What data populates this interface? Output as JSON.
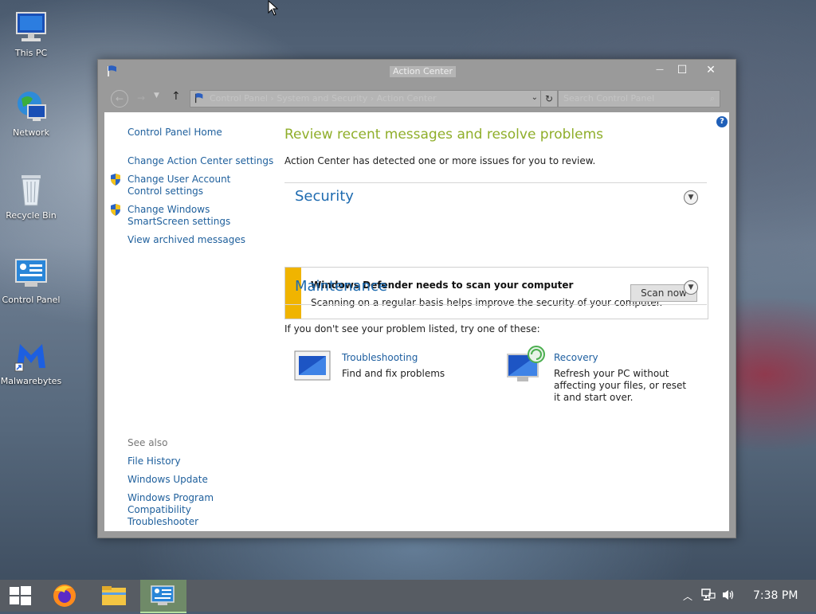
{
  "desktop": {
    "icons": [
      {
        "label": "This PC"
      },
      {
        "label": "Network"
      },
      {
        "label": "Recycle Bin"
      },
      {
        "label": "Control Panel"
      },
      {
        "label": "Malwarebytes"
      }
    ]
  },
  "window": {
    "title": "Action Center",
    "minimize": "—",
    "maximize": "☐",
    "close": "✕"
  },
  "address_bar": {
    "path": "Control Panel › System and Security › Action Center",
    "search_placeholder": "Search Control Panel"
  },
  "left_nav": {
    "home": "Control Panel Home",
    "items": [
      "Change Action Center settings",
      "Change User Account Control settings",
      "Change Windows SmartScreen settings",
      "View archived messages"
    ],
    "see_also_label": "See also",
    "see_also": [
      "File History",
      "Windows Update",
      "Windows Program Compatibility Troubleshooter"
    ]
  },
  "main": {
    "heading": "Review recent messages and resolve problems",
    "subheading": "Action Center has detected one or more issues for you to review.",
    "security": {
      "title": "Security",
      "alert_title": "Windows Defender needs to scan your computer",
      "alert_text": "Scanning on a regular basis helps improve the security of your computer.",
      "alert_button": "Scan now"
    },
    "maintenance": {
      "title": "Maintenance"
    },
    "try_text": "If you don't see your problem listed, try one of these:",
    "troubleshooting": {
      "title": "Troubleshooting",
      "desc": "Find and fix problems"
    },
    "recovery": {
      "title": "Recovery",
      "desc": "Refresh your PC without affecting your files, or reset it and start over."
    }
  },
  "taskbar": {
    "time": "7:38 PM"
  }
}
